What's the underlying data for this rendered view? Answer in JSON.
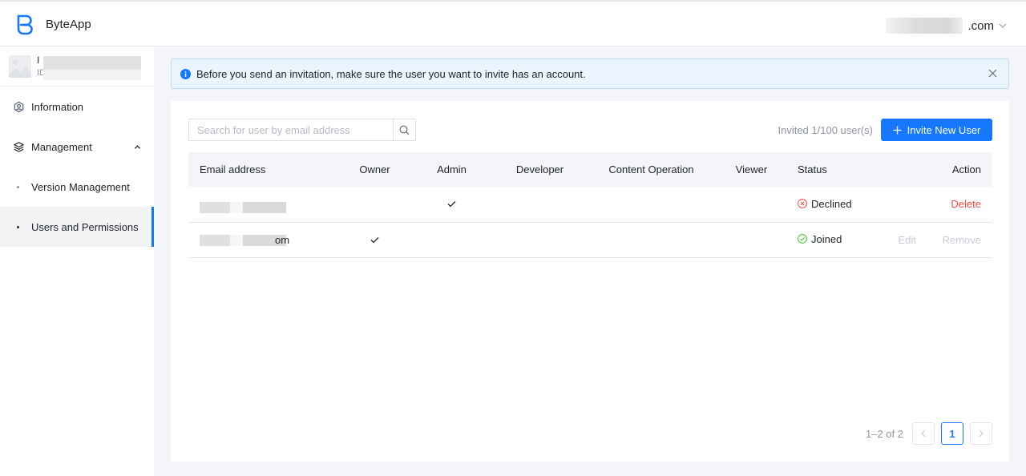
{
  "header": {
    "brand": "ByteApp",
    "account_suffix": ".com",
    "brand_color": "#1677ff"
  },
  "sidebar": {
    "profile": {
      "name_initial": "I",
      "id_label": "ID"
    },
    "items": [
      {
        "label": "Information",
        "icon": "hexagon-person-icon"
      },
      {
        "label": "Management",
        "icon": "layers-icon",
        "expanded": true
      },
      {
        "label": "Version Management",
        "sub": true
      },
      {
        "label": "Users and Permissions",
        "sub": true,
        "active": true
      }
    ]
  },
  "alert": {
    "message": "Before you send an invitation, make sure the user you want to invite has an account."
  },
  "toolbar": {
    "search_placeholder": "Search for user by email address",
    "search_value": "",
    "invited_text": "Invited 1/100 user(s)",
    "invite_button": "Invite New User"
  },
  "table": {
    "columns": [
      "Email address",
      "Owner",
      "Admin",
      "Developer",
      "Content Operation",
      "Viewer",
      "Status",
      "Action"
    ],
    "rows": [
      {
        "email_visible_suffix": "",
        "owner": false,
        "admin": true,
        "developer": false,
        "content_operation": false,
        "viewer": false,
        "status": "Declined",
        "actions": [
          "Delete"
        ]
      },
      {
        "email_visible_suffix": "om",
        "owner": true,
        "admin": false,
        "developer": false,
        "content_operation": false,
        "viewer": false,
        "status": "Joined",
        "actions": [
          "Edit",
          "Remove"
        ]
      }
    ]
  },
  "pagination": {
    "total_text": "1–2 of 2",
    "current_page": "1"
  },
  "colors": {
    "declined": "#f54a45",
    "joined": "#34c724",
    "danger": "#f54a45",
    "disabled": "#c9cdd4"
  }
}
